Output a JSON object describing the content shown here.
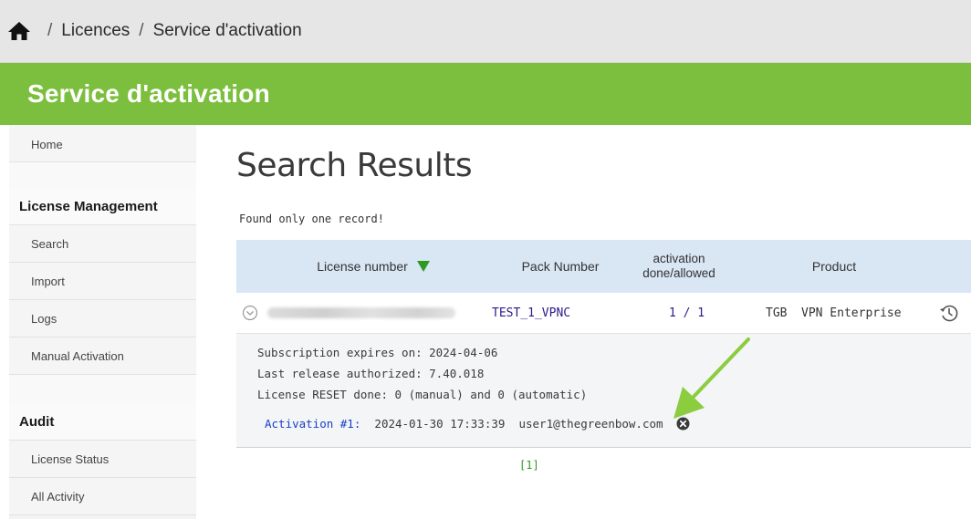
{
  "breadcrumb": {
    "home_icon": "home-icon",
    "separator": "/",
    "items": [
      "Licences",
      "Service d'activation"
    ]
  },
  "banner": {
    "title": "Service d'activation"
  },
  "sidebar": {
    "home": "Home",
    "license_management": {
      "heading": "License Management",
      "items": [
        "Search",
        "Import",
        "Logs",
        "Manual Activation"
      ]
    },
    "audit": {
      "heading": "Audit",
      "items": [
        "License Status",
        "All Activity"
      ]
    }
  },
  "main": {
    "title": "Search Results",
    "found_text": "Found only one record!",
    "table": {
      "headers": {
        "license_number": "License number",
        "pack_number": "Pack Number",
        "activation_line1": "activation",
        "activation_line2": "done/allowed",
        "product": "Product"
      },
      "row": {
        "pack_number": "TEST_1_VPNC",
        "activation": "1 / 1",
        "product_code": "TGB",
        "product_name": "VPN Enterprise"
      },
      "details": {
        "subscription": "Subscription expires on: 2024-04-06",
        "last_release": "Last release authorized: 7.40.018",
        "reset": "License RESET done: 0 (manual) and 0 (automatic)",
        "activation_label": "Activation #1:",
        "activation_date": "2024-01-30 17:33:39",
        "activation_user": "user1@thegreenbow.com"
      }
    },
    "pager": "[1]"
  },
  "colors": {
    "banner": "#7cbf3e",
    "table_header": "#d9e6f4",
    "link": "#2b1a8c",
    "arrow": "#8ccc3f",
    "pager": "#2e9a22"
  }
}
